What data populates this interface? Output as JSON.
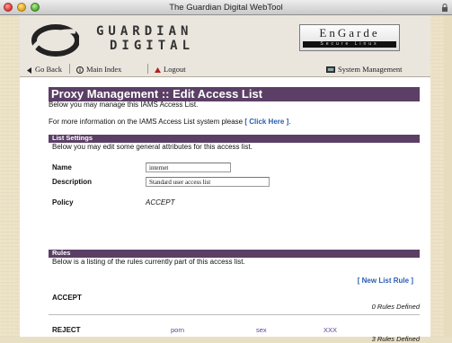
{
  "window": {
    "title": "The Guardian Digital WebTool"
  },
  "header": {
    "logo_line1": "GUARDIAN",
    "logo_line2": "DIGITAL",
    "engarde_word": "EnGarde",
    "engarde_sub": "Secure Linux"
  },
  "nav": {
    "back": "Go Back",
    "main_index": "Main Index",
    "logout": "Logout",
    "system_management": "System Management"
  },
  "page": {
    "title": "Proxy Management :: Edit Access List",
    "intro": "Below you may manage this IAMS Access List.",
    "info_prefix": "For more information on the IAMS Access List system please",
    "info_link": "[ Click Here ]",
    "info_suffix": "."
  },
  "list_settings": {
    "heading": "List Settings",
    "description": "Below you may edit some general attributes for this access list.",
    "name_label": "Name",
    "name_value": "internet",
    "description_label": "Description",
    "description_value": "Standard user access list",
    "policy_label": "Policy",
    "policy_value": "ACCEPT"
  },
  "rules": {
    "heading": "Rules",
    "description": "Below is a listing of the rules currently part of this access list.",
    "new_rule_link": "[ New List Rule ]",
    "groups": [
      {
        "name": "ACCEPT",
        "entries": [],
        "count_label": "0 Rules Defined"
      },
      {
        "name": "REJECT",
        "entries": [
          "porn",
          "sex",
          "XXX"
        ],
        "count_label": "3 Rules Defined"
      }
    ]
  },
  "colors": {
    "section_bar": "#5b3f66",
    "link": "#2a5db0",
    "rule_entry": "#5b3f9a"
  }
}
